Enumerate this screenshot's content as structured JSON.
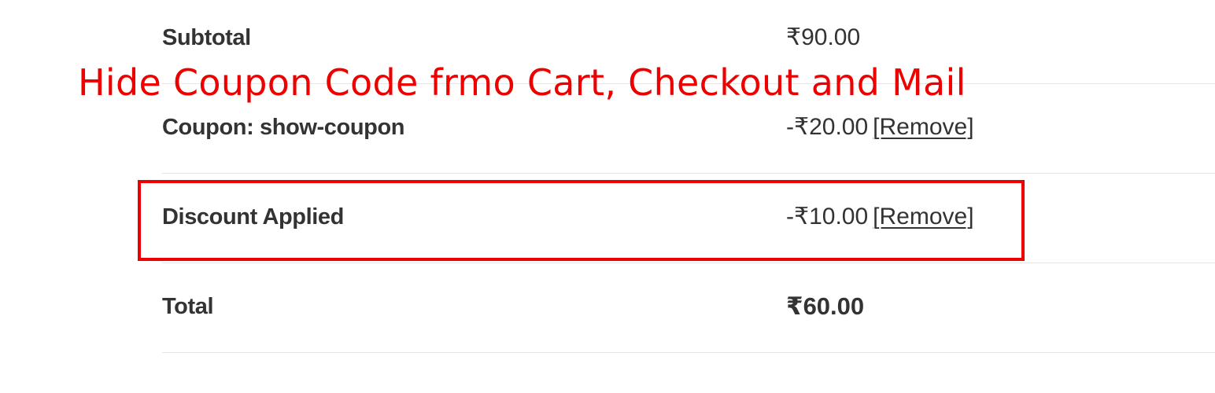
{
  "annotation": {
    "title": "Hide Coupon Code frmo Cart, Checkout and Mail",
    "color": "#ee0000"
  },
  "cart_totals": {
    "subtotal": {
      "label": "Subtotal",
      "value": "₹90.00"
    },
    "coupon": {
      "label": "Coupon: show-coupon",
      "value": "-₹20.00",
      "remove_label": "[Remove]"
    },
    "discount": {
      "label": "Discount Applied",
      "value": "-₹10.00",
      "remove_label": "[Remove]"
    },
    "total": {
      "label": "Total",
      "value": "₹60.00"
    }
  }
}
